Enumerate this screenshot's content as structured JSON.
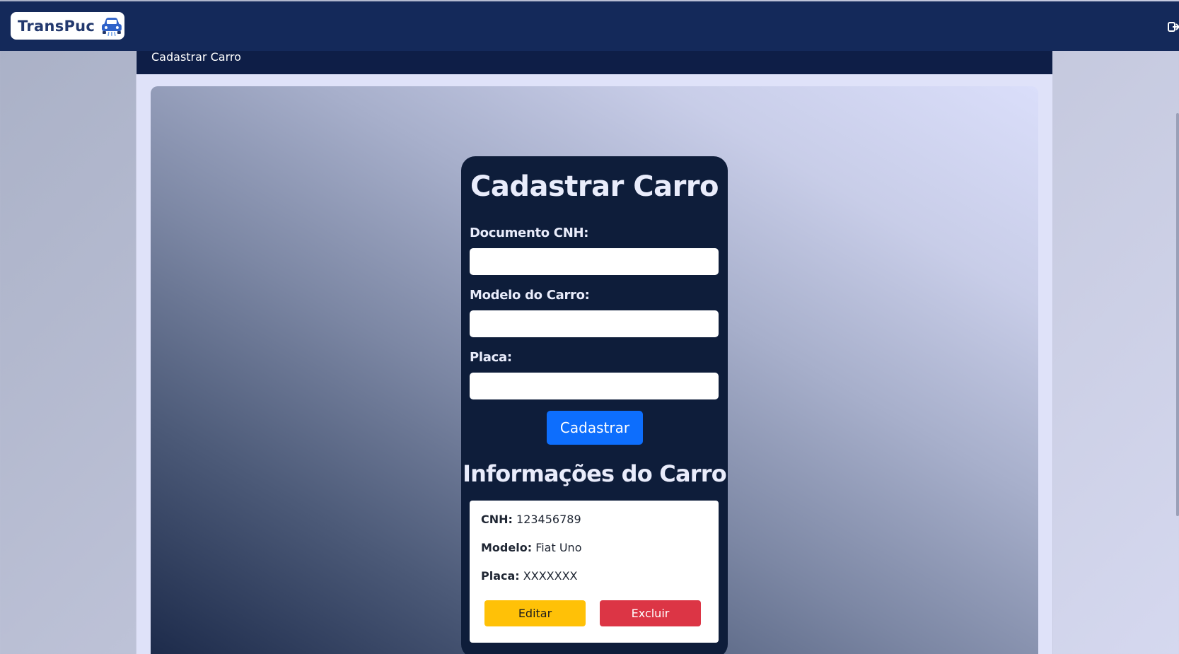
{
  "header": {
    "brand": "TransPuc",
    "logout_icon": "logout-icon"
  },
  "subheader": {
    "title": "Cadastrar Carro"
  },
  "form": {
    "title": "Cadastrar Carro",
    "fields": [
      {
        "label": "Documento CNH:",
        "value": "",
        "placeholder": ""
      },
      {
        "label": "Modelo do Carro:",
        "value": "",
        "placeholder": ""
      },
      {
        "label": "Placa:",
        "value": "",
        "placeholder": ""
      }
    ],
    "submit_label": "Cadastrar"
  },
  "info": {
    "title": "Informações do Carro",
    "rows": [
      {
        "key": "CNH:",
        "value": "123456789"
      },
      {
        "key": "Modelo:",
        "value": "Fiat Uno"
      },
      {
        "key": "Placa:",
        "value": "XXXXXXX"
      }
    ],
    "edit_label": "Editar",
    "delete_label": "Excluir"
  },
  "colors": {
    "topbar": "#14295a",
    "card": "#0e1d3a",
    "primary": "#0d6efd",
    "warning": "#ffc107",
    "danger": "#dc3545"
  }
}
